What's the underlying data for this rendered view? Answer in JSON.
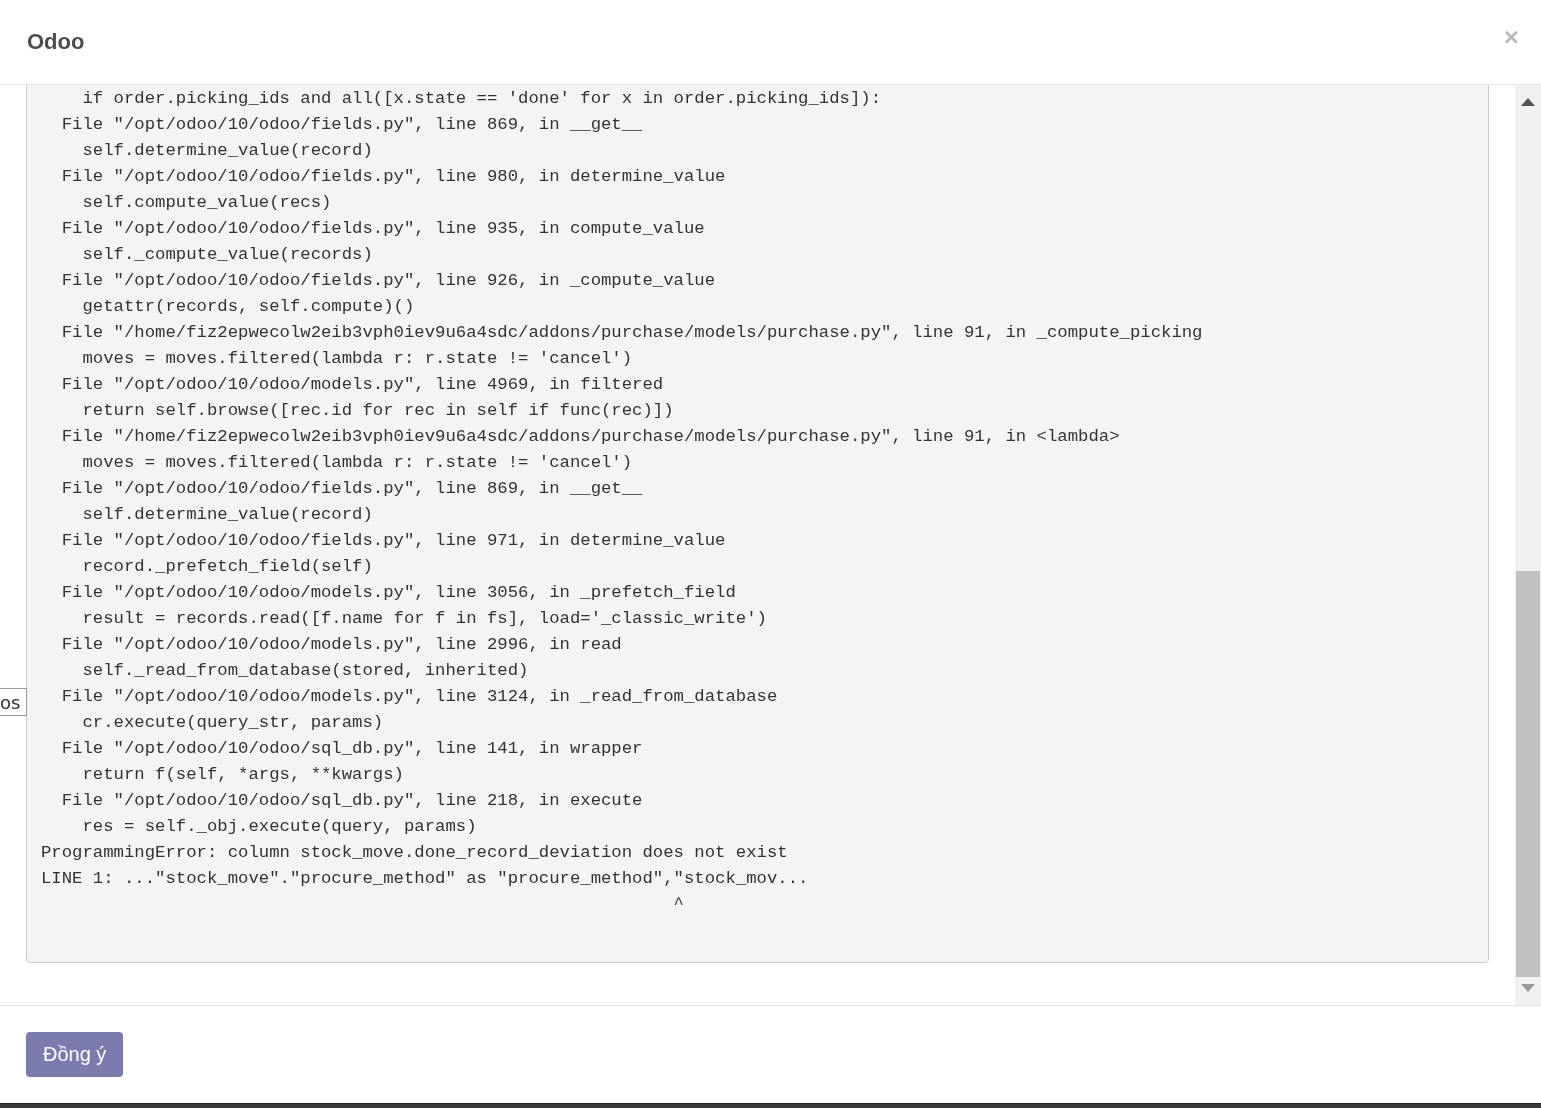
{
  "background_tooltip": {
    "text": "os"
  },
  "dialog": {
    "title": "Odoo",
    "close": "×",
    "traceback": [
      "    if order.picking_ids and all([x.state == 'done' for x in order.picking_ids]):",
      "  File \"/opt/odoo/10/odoo/fields.py\", line 869, in __get__",
      "    self.determine_value(record)",
      "  File \"/opt/odoo/10/odoo/fields.py\", line 980, in determine_value",
      "    self.compute_value(recs)",
      "  File \"/opt/odoo/10/odoo/fields.py\", line 935, in compute_value",
      "    self._compute_value(records)",
      "  File \"/opt/odoo/10/odoo/fields.py\", line 926, in _compute_value",
      "    getattr(records, self.compute)()",
      "  File \"/home/fiz2epwecolw2eib3vph0iev9u6a4sdc/addons/purchase/models/purchase.py\", line 91, in _compute_picking",
      "    moves = moves.filtered(lambda r: r.state != 'cancel')",
      "  File \"/opt/odoo/10/odoo/models.py\", line 4969, in filtered",
      "    return self.browse([rec.id for rec in self if func(rec)])",
      "  File \"/home/fiz2epwecolw2eib3vph0iev9u6a4sdc/addons/purchase/models/purchase.py\", line 91, in <lambda>",
      "    moves = moves.filtered(lambda r: r.state != 'cancel')",
      "  File \"/opt/odoo/10/odoo/fields.py\", line 869, in __get__",
      "    self.determine_value(record)",
      "  File \"/opt/odoo/10/odoo/fields.py\", line 971, in determine_value",
      "    record._prefetch_field(self)",
      "  File \"/opt/odoo/10/odoo/models.py\", line 3056, in _prefetch_field",
      "    result = records.read([f.name for f in fs], load='_classic_write')",
      "  File \"/opt/odoo/10/odoo/models.py\", line 2996, in read",
      "    self._read_from_database(stored, inherited)",
      "  File \"/opt/odoo/10/odoo/models.py\", line 3124, in _read_from_database",
      "    cr.execute(query_str, params)",
      "  File \"/opt/odoo/10/odoo/sql_db.py\", line 141, in wrapper",
      "    return f(self, *args, **kwargs)",
      "  File \"/opt/odoo/10/odoo/sql_db.py\", line 218, in execute",
      "    res = self._obj.execute(query, params)",
      "ProgrammingError: column stock_move.done_record_deviation does not exist",
      "LINE 1: ...\"stock_move\".\"procure_method\" as \"procure_method\",\"stock_mov...",
      "                                                             ^"
    ],
    "buttons": [
      {
        "label": "Đồng ý",
        "kind": "primary"
      }
    ]
  }
}
